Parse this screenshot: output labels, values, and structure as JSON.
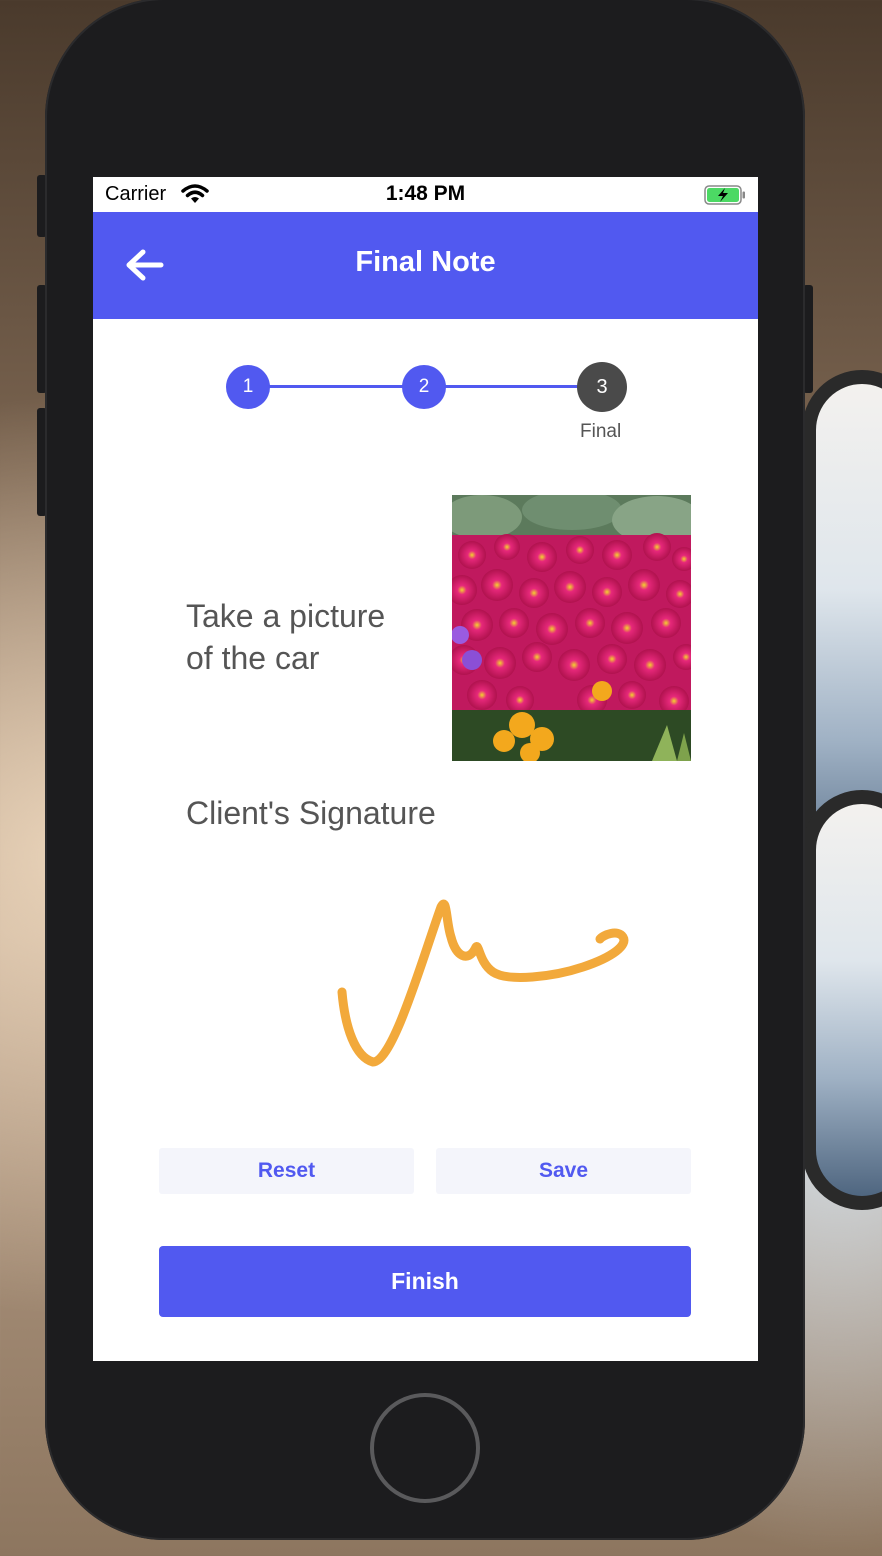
{
  "status_bar": {
    "carrier": "Carrier",
    "time": "1:48 PM"
  },
  "nav": {
    "title": "Final Note",
    "back_icon": "arrow-left-icon"
  },
  "stepper": {
    "steps": [
      {
        "number": "1",
        "label": ""
      },
      {
        "number": "2",
        "label": ""
      },
      {
        "number": "3",
        "label": "Final"
      }
    ],
    "current_step": 3
  },
  "photo_section": {
    "label_line1": "Take a picture",
    "label_line2": "of the car"
  },
  "signature_section": {
    "label": "Client's Signature",
    "stroke_color": "#f2a93b"
  },
  "buttons": {
    "reset": "Reset",
    "save": "Save",
    "finish": "Finish"
  },
  "colors": {
    "accent": "#5159f0",
    "active_step": "#4a4a4a"
  }
}
